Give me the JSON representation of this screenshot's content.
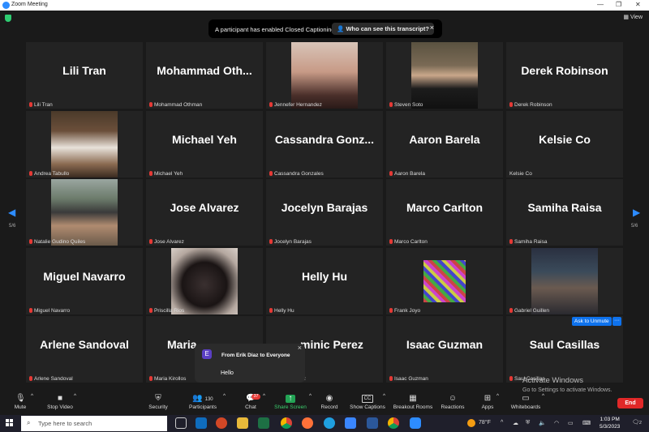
{
  "window": {
    "title": "Zoom Meeting"
  },
  "top": {
    "view_label": "View"
  },
  "notice": {
    "message": "A participant has enabled Closed Captioning",
    "link": "Who can see this transcript?",
    "close": "×"
  },
  "nav": {
    "left_page": "5/6",
    "right_page": "5/6"
  },
  "tiles": [
    {
      "big": "Lili Tran",
      "label": "Lili Tran"
    },
    {
      "big": "Mohammad  Oth...",
      "label": "Mohammad Othman"
    },
    {
      "big": "",
      "label": "Jennefer Hernandez"
    },
    {
      "big": "",
      "label": "Steven Soto"
    },
    {
      "big": "Derek Robinson",
      "label": "Derek Robinson"
    },
    {
      "big": "",
      "label": "Andrea Tabullo"
    },
    {
      "big": "Michael Yeh",
      "label": "Michael Yeh"
    },
    {
      "big": "Cassandra  Gonz...",
      "label": "Cassandra Gonzales"
    },
    {
      "big": "Aaron Barela",
      "label": "Aaron Barela"
    },
    {
      "big": "Kelsie Co",
      "label": "Kelsie Co"
    },
    {
      "big": "",
      "label": "Natalie Gudino Quiles"
    },
    {
      "big": "Jose Alvarez",
      "label": "Jose Alvarez"
    },
    {
      "big": "Jocelyn Barajas",
      "label": "Jocelyn Barajas"
    },
    {
      "big": "Marco Carlton",
      "label": "Marco Carlton"
    },
    {
      "big": "Samiha Raisa",
      "label": "Samiha Raisa"
    },
    {
      "big": "Miguel Navarro",
      "label": "Miguel Navarro"
    },
    {
      "big": "",
      "label": "Priscilla Rios"
    },
    {
      "big": "Helly Hu",
      "label": "Helly Hu"
    },
    {
      "big": "",
      "label": "Frank Joyo"
    },
    {
      "big": "",
      "label": "Gabriel Guillen"
    },
    {
      "big": "Arlene Sandoval",
      "label": "Arlene Sandoval"
    },
    {
      "big": "Maria",
      "label": "Maria Kirollos"
    },
    {
      "big": "minic Perez",
      "label": "ez"
    },
    {
      "big": "Isaac Guzman",
      "label": "Isaac Guzman"
    },
    {
      "big": "Saul Casillas",
      "label": "Saul Casillas"
    }
  ],
  "ask_unmute": "Ask to Unmute",
  "more_dots": "···",
  "chat_popup": {
    "avatar": "E",
    "from": "From Erik Diaz to Everyone",
    "message": "Hello",
    "close": "×"
  },
  "toolbar": {
    "mute": "Mute",
    "stop_video": "Stop Video",
    "security": "Security",
    "participants": "Participants",
    "participants_count": "130",
    "chat": "Chat",
    "chat_badge": "37",
    "share_screen": "Share Screen",
    "record": "Record",
    "show_captions": "Show Captions",
    "cc_glyph": "CC",
    "breakout_rooms": "Breakout Rooms",
    "reactions": "Reactions",
    "apps": "Apps",
    "whiteboards": "Whiteboards",
    "end": "End"
  },
  "watermark": {
    "title": "Activate Windows",
    "subtitle": "Go to Settings to activate Windows."
  },
  "taskbar": {
    "search_placeholder": "Type here to search",
    "weather": "78°F",
    "time": "1:03 PM",
    "date": "5/3/2023",
    "notif_count": "2"
  },
  "colors": {
    "accent": "#2d8cff",
    "end": "#e02828",
    "muted_mic": "#e53935",
    "tile": "#232323"
  }
}
